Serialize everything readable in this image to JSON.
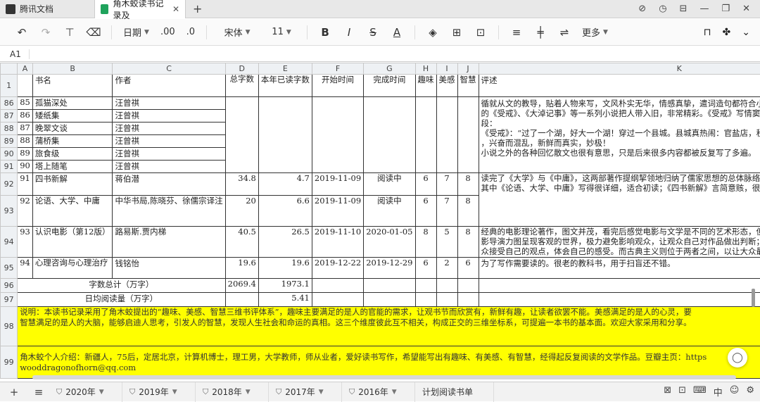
{
  "window": {
    "tabs": [
      {
        "label": "腾讯文档",
        "active": false
      },
      {
        "label": "角木蛟读书记录及",
        "active": true
      }
    ]
  },
  "toolbar": {
    "date_format": "日期",
    "decimals": ".00",
    "font_name": "宋体",
    "font_size": "11",
    "more_label": "更多"
  },
  "formula_bar": {
    "cell_ref": "A1",
    "value": ""
  },
  "columns": [
    "A",
    "B",
    "C",
    "D",
    "E",
    "F",
    "G",
    "H",
    "I",
    "J",
    "K"
  ],
  "header_row": {
    "row_no": "1",
    "a": "",
    "b": "书名",
    "c": "作者",
    "d": "总字数",
    "e": "本年已读字数",
    "f": "开始时间",
    "g": "完成时间",
    "h": "趣味",
    "i": "美感",
    "j": "智慧",
    "k": "评述"
  },
  "rows": [
    {
      "row_no": "86",
      "a": "85",
      "b": "孤猫深处",
      "c": "汪曾祺"
    },
    {
      "row_no": "87",
      "a": "86",
      "b": "矮纸集",
      "c": "汪曾祺"
    },
    {
      "row_no": "88",
      "a": "87",
      "b": "晚翠文谈",
      "c": "汪曾祺"
    },
    {
      "row_no": "89",
      "a": "88",
      "b": "蒲桥集",
      "c": "汪曾祺"
    },
    {
      "row_no": "90",
      "a": "89",
      "b": "旅食级",
      "c": "汪曾祺"
    },
    {
      "row_no": "91",
      "a": "90",
      "b": "塔上随笔",
      "c": "汪曾祺"
    },
    {
      "row_no": "92",
      "a": "91",
      "b": "四书新解",
      "c": "蒋伯潜",
      "d": "34.8",
      "e": "4.7",
      "f": "2019-11-09",
      "g": "阅读中",
      "h": "6",
      "i": "7",
      "j": "8"
    },
    {
      "row_no": "93",
      "a": "92",
      "b": "论语、大学、中庸",
      "c": "中华书局,陈晓芬、徐儒宗译注",
      "d": "20",
      "e": "6.6",
      "f": "2019-11-09",
      "g": "阅读中",
      "h": "6",
      "i": "7",
      "j": "8"
    },
    {
      "row_no": "94",
      "a": "93",
      "b": "认识电影（第12版）",
      "c": "路易斯.贾内梯",
      "d": "40.5",
      "e": "26.5",
      "f": "2019-11-10",
      "g": "2020-01-05",
      "h": "8",
      "i": "5",
      "j": "8"
    },
    {
      "row_no": "95",
      "a": "94",
      "b": "心理咨询与心理治疗",
      "c": "钱铭怡",
      "d": "19.6",
      "e": "19.6",
      "f": "2019-12-22",
      "g": "2019-12-29",
      "h": "6",
      "i": "2",
      "j": "6"
    },
    {
      "row_no": "96",
      "label": "字数总计（万字）",
      "d": "2069.4",
      "e": "1973.1"
    },
    {
      "row_no": "97",
      "label": "日均阅读量（万字）",
      "e": "5.41"
    }
  ],
  "reviews": {
    "wang_lines": [
      "循就从文的教导，贴着人物来写，文风朴实无华，情感真挚，遣词造句都符合小说的意境和人物的个性。整体上",
      "的《受戒》、《大淖记事》等一系列小说把人带入旧，非常精彩。《受戒》写情窦初开的小和尚和小女孩，非常美",
      "段：",
      "《受戒》：“过了一个湖，好大一个湖！穿过一个县城。县城真热闹：官盐店，税务局，肉铺里挂着成边的猪，",
      "，兴奋而混乱，新鲜而真实，妙极！",
      "小说之外的各种回忆散文也很有意思，只是后来很多内容都被反复写了多遍。"
    ],
    "r92_lines": [
      "读完了《大学》与《中庸》，这两部著作提纲挈领地归纳了儒家思想的总体脉络。",
      "其中《论语、大学、中庸》写得很详细，适合初读；《四书新解》言简意赅，很有想法，适合提高。"
    ],
    "r94_lines": [
      "经典的电影理论著作，图文并茂，看完后感觉电影与文学是不同的艺术形态，但又有共通之处。如书中讲，现实",
      "影导演力图呈现客观的世界，极力避免影响观众，让观众自己对作品做出判断；形式主义则相反，其导演在电影",
      "众接受自己的观点，体会自己的感受。而古典主义则位于两者之间，以让大众最容易理解和接受为准则，因而成"
    ],
    "r95": "为了写作需要读的。很老的教科书，用于扫盲还不错。"
  },
  "notes": {
    "row98_no": "98",
    "row99_no": "99",
    "row100_no": "100",
    "line1": "说明：本读书记录采用了角木蛟提出的“趣味、美感、智慧三维书评体系”，趣味主要满足的是人的官能的需求，让观书节而欣赏有，新鲜有趣，让读者欲罢不能。美感满足的是人的心灵，要",
    "line2": "智慧满足的是人的大脑，能够启迪人思考，引发人的智慧，发现人生社会和命运的真相。这三个维度彼此互不相关，构成正交的三维坐标系，可提遍一本书的基本面。欢迎大家采用和分享。",
    "line3": "角木蛟个人介绍：新疆人，75后，定居北京，计算机博士，理工男，大学教师，师从业者，爱好读书写作，希望能写出有趣味、有美感、有智慧，经得起反复阅读的文学作品。豆瓣主页：https",
    "line4": "wooddragonofhorn@qq.com"
  },
  "sheet_tabs": [
    "2020年",
    "2019年",
    "2018年",
    "2017年",
    "2016年",
    "计划阅读书单"
  ],
  "status_right": {
    "lang": "中"
  }
}
